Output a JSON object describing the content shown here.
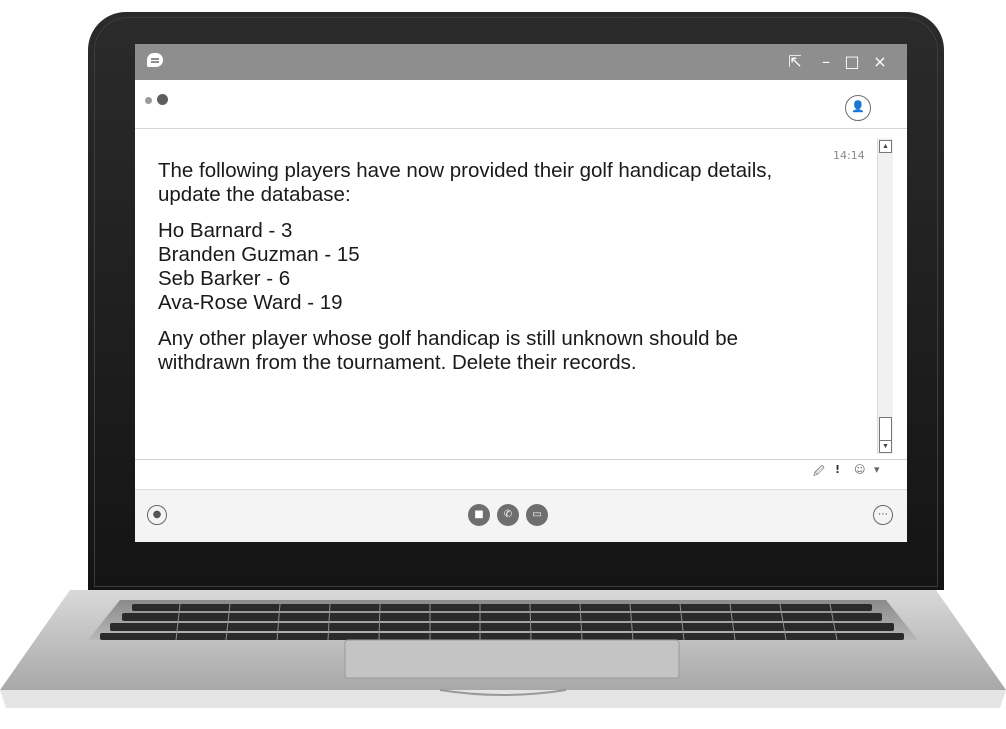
{
  "window": {
    "app_icon": "chat-bubble-icon",
    "controls": {
      "popout": "⇱",
      "minimize": "–",
      "maximize": "□",
      "close": "×"
    }
  },
  "conversation": {
    "timestamp": "14:14",
    "message": {
      "intro": "The following players have now provided their golf handicap details, update the database:",
      "players": [
        "Ho Barnard - 3",
        "Branden Guzman - 15",
        "Seb Barker - 6",
        "Ava-Rose Ward - 19"
      ],
      "closing": "Any other player whose golf handicap is still unknown should be withdrawn from the tournament.  Delete their records."
    }
  },
  "compose_tools": {
    "attach": "🖉",
    "priority": "!",
    "emoji": "☺",
    "more": "▾"
  },
  "bottom_bar": {
    "video": "■",
    "call": "✆",
    "screen_share": "▭",
    "more": "⋯"
  },
  "colors": {
    "titlebar": "#8e8e8e",
    "bezel": "#1a1a1a",
    "text": "#1a1a1a"
  }
}
